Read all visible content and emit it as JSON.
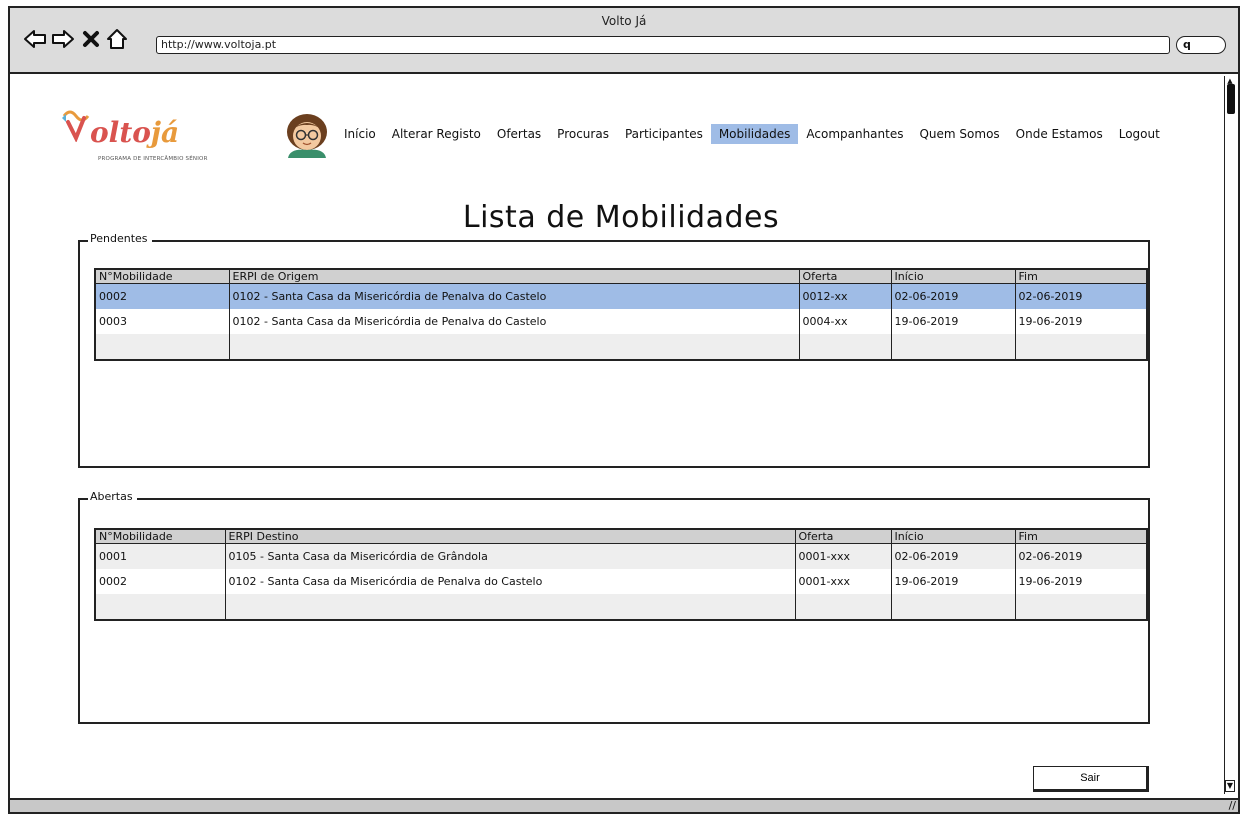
{
  "window": {
    "title": "Volto Já",
    "url": "http://www.voltoja.pt",
    "search_icon": "q"
  },
  "logo": {
    "text_main": "olto",
    "text_accent": "já",
    "subtitle": "PROGRAMA DE INTERCÂMBIO SÉNIOR"
  },
  "menu": {
    "items": [
      {
        "label": "Início"
      },
      {
        "label": "Alterar Registo"
      },
      {
        "label": "Ofertas"
      },
      {
        "label": "Procuras"
      },
      {
        "label": "Participantes"
      },
      {
        "label": "Mobilidades"
      },
      {
        "label": "Acompanhantes"
      },
      {
        "label": "Quem Somos"
      },
      {
        "label": "Onde Estamos"
      },
      {
        "label": "Logout"
      }
    ],
    "active": "Mobilidades"
  },
  "page": {
    "title": "Lista de Mobilidades"
  },
  "pendentes": {
    "label": "Pendentes",
    "columns": [
      "N°Mobilidade",
      "ERPI de Origem",
      "Oferta",
      "Início",
      "Fim"
    ],
    "rows": [
      [
        "0002",
        "0102 - Santa Casa da Misericórdia de Penalva do Castelo",
        "0012-xx",
        "02-06-2019",
        "02-06-2019"
      ],
      [
        "0003",
        "0102 - Santa Casa da Misericórdia de Penalva do Castelo",
        "0004-xx",
        "19-06-2019",
        "19-06-2019"
      ]
    ]
  },
  "abertas": {
    "label": "Abertas",
    "columns": [
      "N°Mobilidade",
      "ERPI Destino",
      "Oferta",
      "Início",
      "Fim"
    ],
    "rows": [
      [
        "0001",
        "0105 -  Santa Casa da Misericórdia de Grândola",
        "0001-xxx",
        "02-06-2019",
        "02-06-2019"
      ],
      [
        "0002",
        "0102 - Santa Casa da Misericórdia de Penalva do Castelo",
        "0001-xxx",
        "19-06-2019",
        "19-06-2019"
      ]
    ]
  },
  "footer": {
    "sair_label": "Sair"
  },
  "colors": {
    "accent": "#9fbce6",
    "logo_red": "#d9534f",
    "logo_orange": "#e89a3c"
  }
}
